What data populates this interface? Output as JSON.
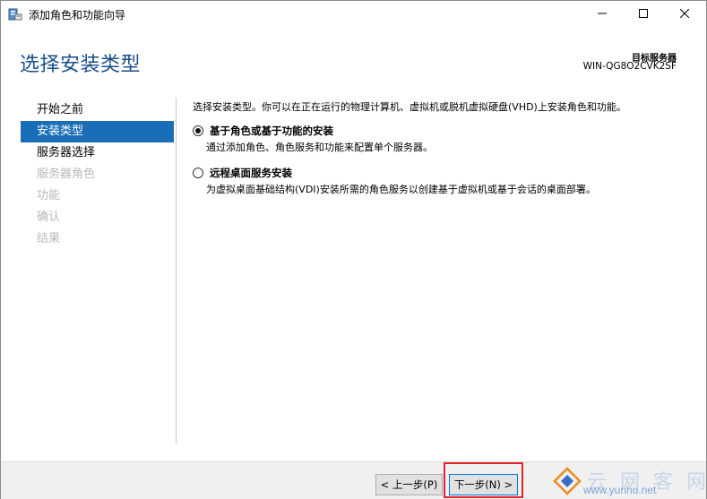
{
  "window": {
    "title": "添加角色和功能向导",
    "app_icon": "server-wizard-icon",
    "controls": {
      "minimize_icon": "minimize-icon",
      "maximize_icon": "maximize-icon",
      "close_icon": "close-icon"
    }
  },
  "header": {
    "page_title": "选择安装类型",
    "target_server_label": "目标服务器",
    "target_server_name": "WIN-QG8O2CVK2SF"
  },
  "sidebar": {
    "items": [
      {
        "label": "开始之前",
        "state": "normal"
      },
      {
        "label": "安装类型",
        "state": "active"
      },
      {
        "label": "服务器选择",
        "state": "normal"
      },
      {
        "label": "服务器角色",
        "state": "disabled"
      },
      {
        "label": "功能",
        "state": "disabled"
      },
      {
        "label": "确认",
        "state": "disabled"
      },
      {
        "label": "结果",
        "state": "disabled"
      }
    ]
  },
  "content": {
    "intro": "选择安装类型。你可以在正在运行的物理计算机、虚拟机或脱机虚拟硬盘(VHD)上安装角色和功能。",
    "options": [
      {
        "label": "基于角色或基于功能的安装",
        "description": "通过添加角色、角色服务和功能来配置单个服务器。",
        "checked": true
      },
      {
        "label": "远程桌面服务安装",
        "description": "为虚拟桌面基础结构(VDI)安装所需的角色服务以创建基于虚拟机或基于会话的桌面部署。",
        "checked": false
      }
    ]
  },
  "footer": {
    "prev_label": "< 上一步(P)",
    "next_label": "下一步(N) >"
  },
  "watermark": {
    "text": "云 网 客 网",
    "url": "www.yunhu.net"
  },
  "colors": {
    "accent": "#1a6db7",
    "title_blue": "#1a4f8a",
    "highlight_red": "#e0262b",
    "disabled_text": "#b8b8b8"
  }
}
